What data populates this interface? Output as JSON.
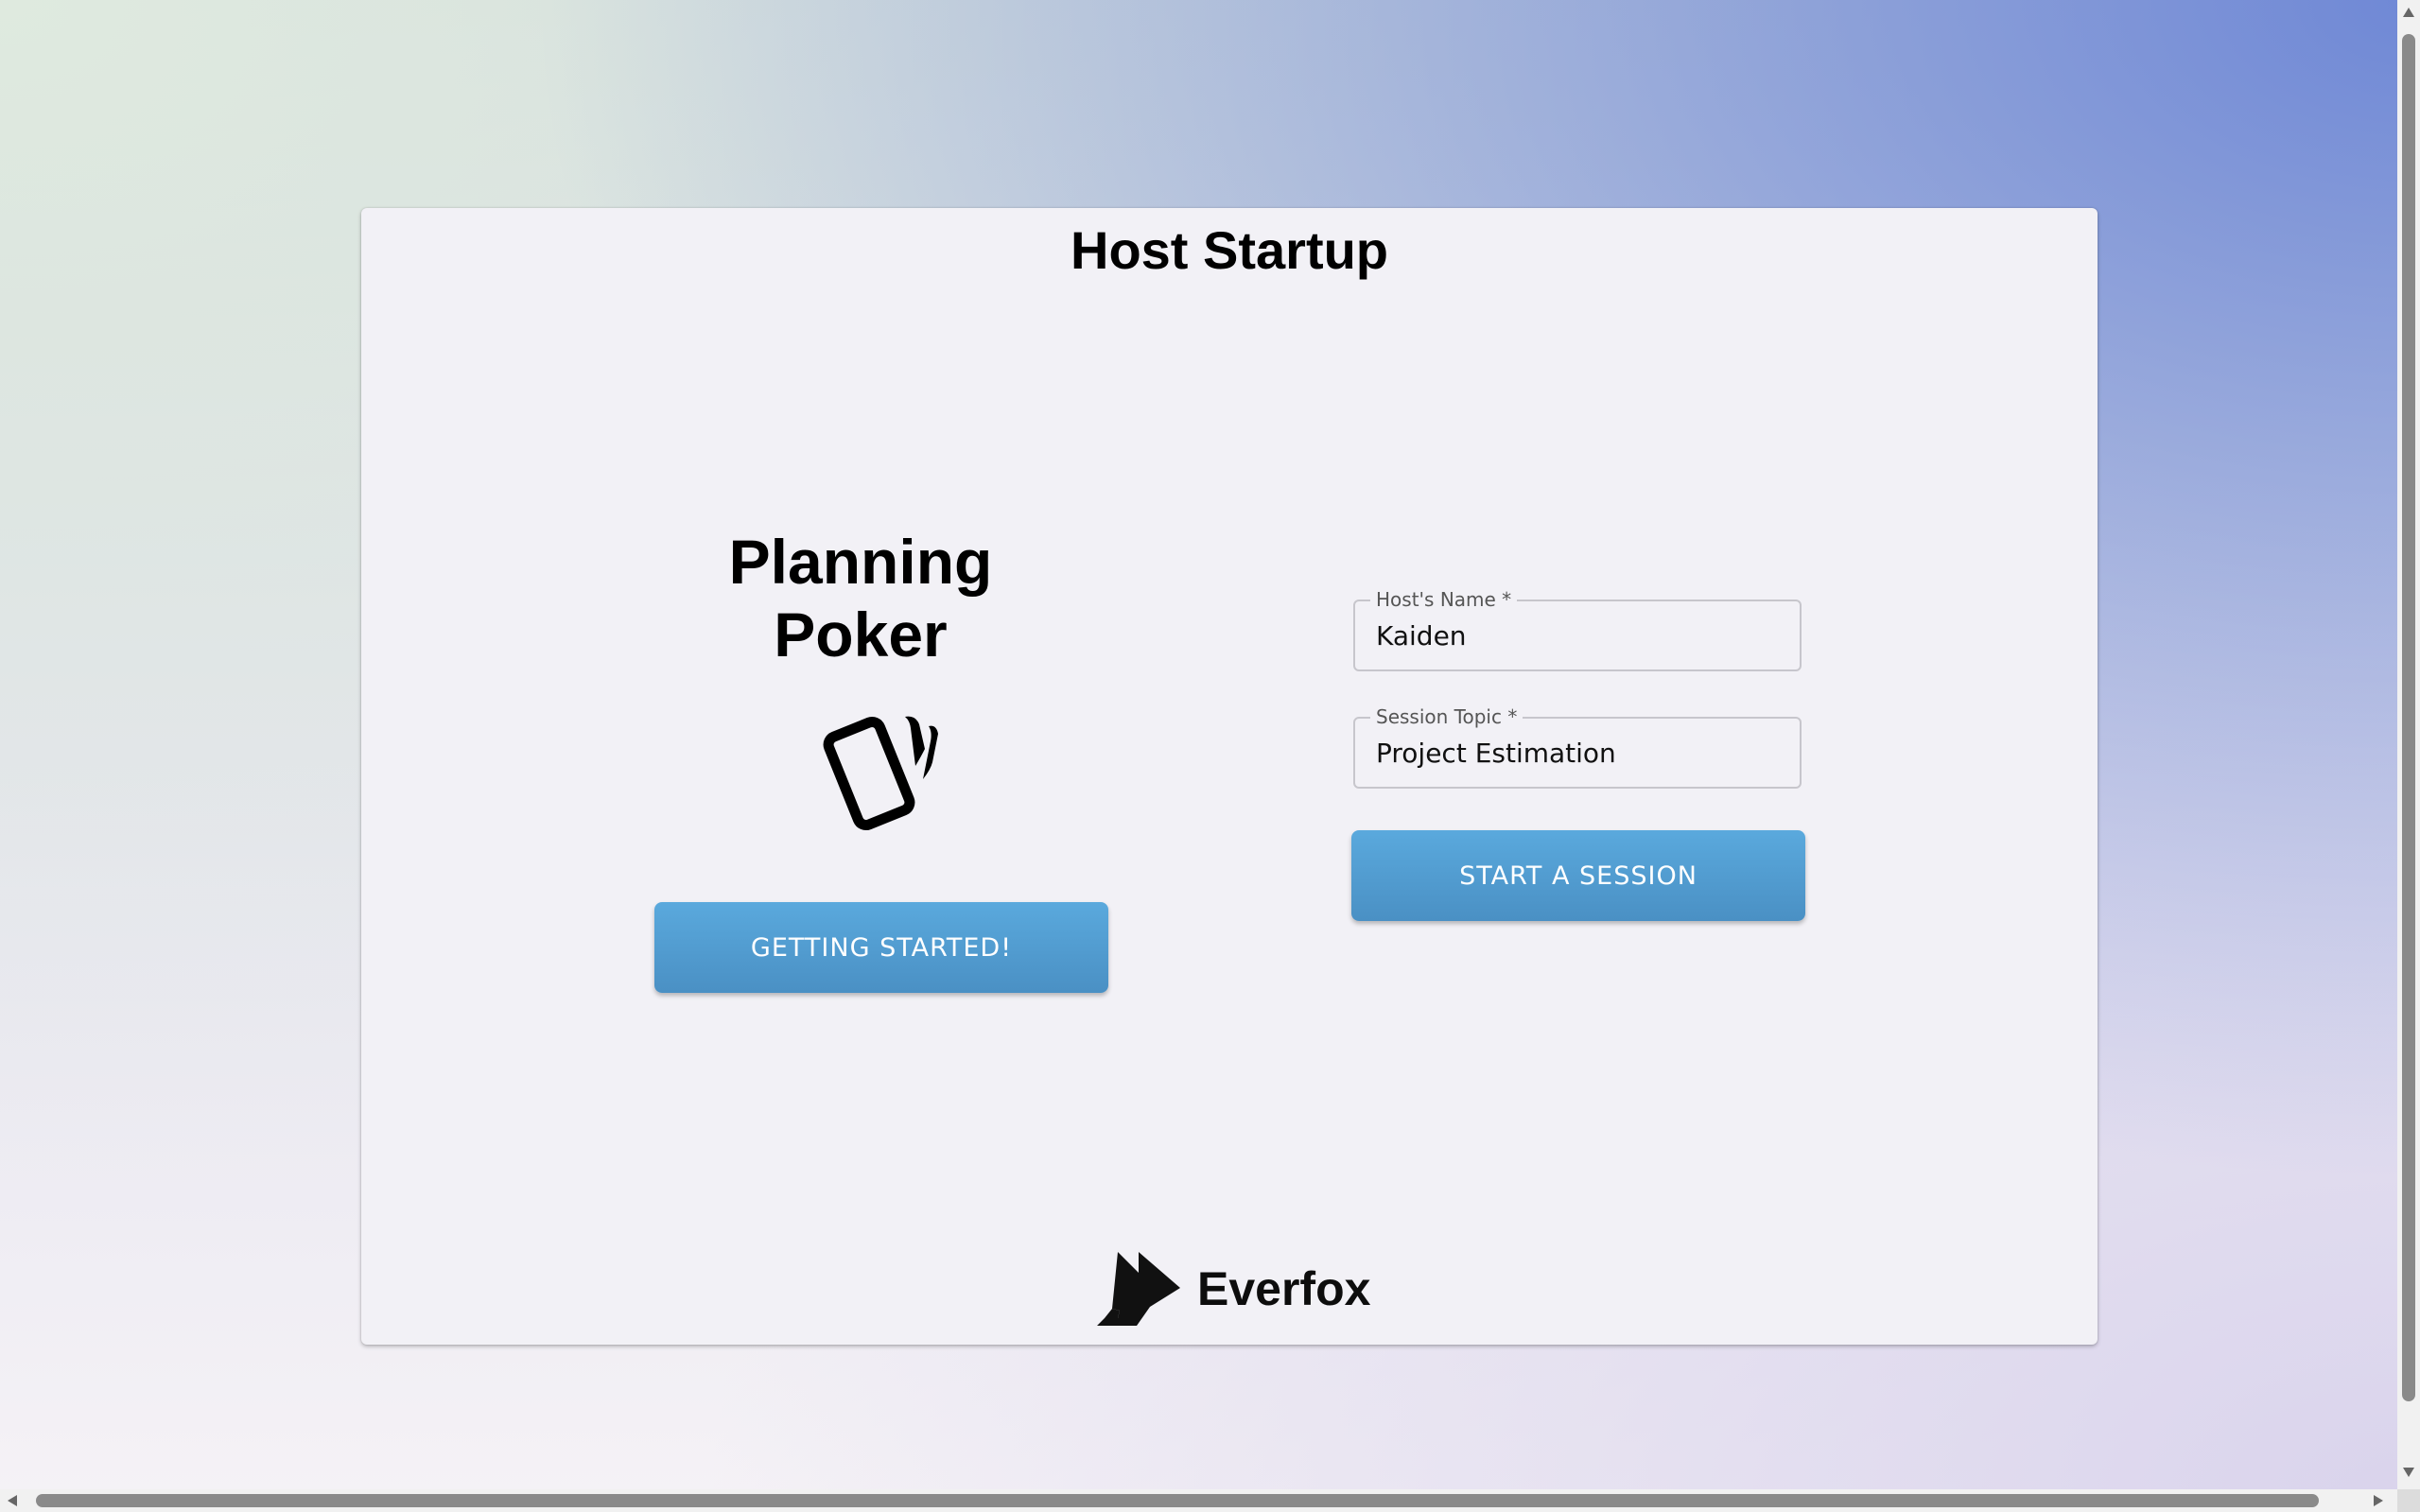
{
  "page": {
    "title": "Host Startup"
  },
  "branding": {
    "app_title_line1": "Planning",
    "app_title_line2": "Poker",
    "app_icon": "cards-icon",
    "company_name": "Everfox",
    "company_logo": "everfox-logo-icon"
  },
  "actions": {
    "getting_started_label": "GETTING STARTED!",
    "start_session_label": "START A SESSION"
  },
  "form": {
    "host_name": {
      "label": "Host's Name *",
      "value": "Kaiden"
    },
    "session_topic": {
      "label": "Session Topic *",
      "value": "Project Estimation"
    }
  },
  "colors": {
    "button": "#4f9bd0",
    "card_background": "#f2f1f6",
    "text": "#000000"
  }
}
